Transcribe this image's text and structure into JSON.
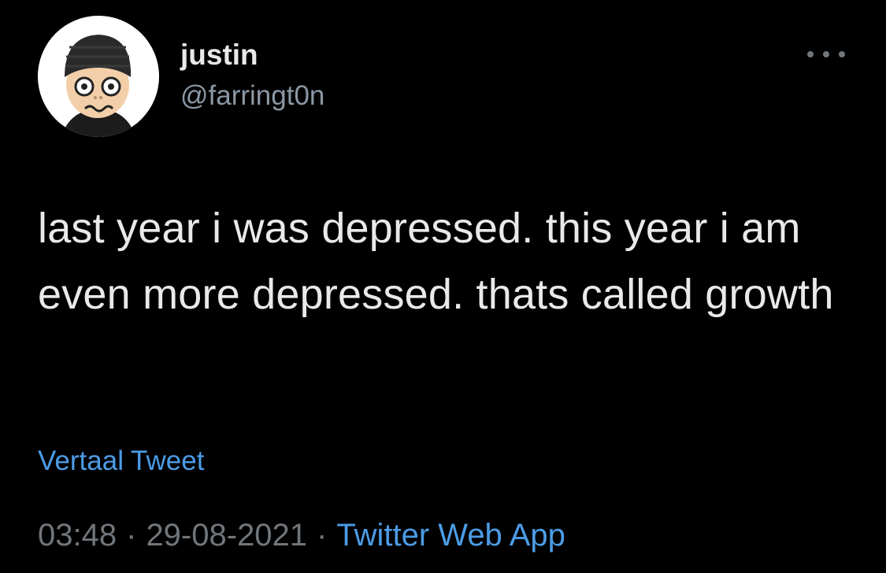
{
  "tweet": {
    "author": {
      "display_name": "justin",
      "handle": "@farringt0n",
      "avatar_icon": "mii-avatar-icon"
    },
    "more_icon": "more-dots-icon",
    "text": "last year i was depressed. this year i am even more depressed. thats called growth",
    "translate_label": "Vertaal Tweet",
    "time": "03:48",
    "separator": "·",
    "date": "29-08-2021",
    "source": "Twitter Web App"
  },
  "colors": {
    "background": "#000000",
    "primary_text": "#e7e9ea",
    "secondary_text": "#71767b",
    "link": "#4c9ce6"
  }
}
